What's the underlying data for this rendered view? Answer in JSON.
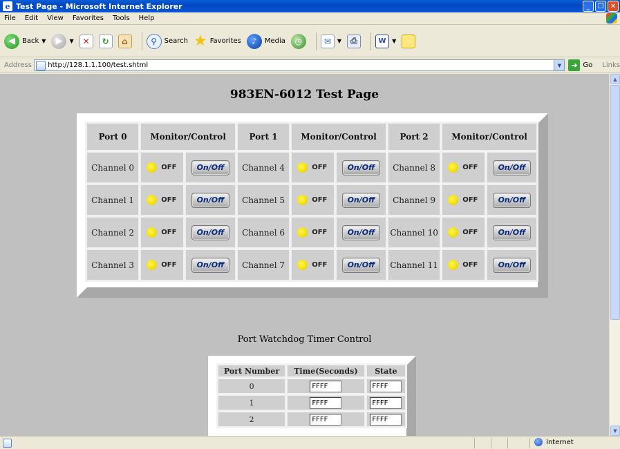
{
  "window": {
    "title": "Test Page - Microsoft Internet Explorer"
  },
  "menu": [
    "File",
    "Edit",
    "View",
    "Favorites",
    "Tools",
    "Help"
  ],
  "toolbar": {
    "back": "Back",
    "search": "Search",
    "favorites": "Favorites",
    "media": "Media"
  },
  "address": {
    "label": "Address",
    "url": "http://128.1.1.100/test.shtml",
    "go": "Go",
    "links": "Links"
  },
  "page": {
    "title": "983EN-6012 Test Page"
  },
  "io_table": {
    "headers": [
      "Port 0",
      "Monitor/Control",
      "Port 1",
      "Monitor/Control",
      "Port 2",
      "Monitor/Control"
    ],
    "button_label": "On/Off",
    "rows": [
      [
        {
          "channel": "Channel 0",
          "state": "OFF"
        },
        {
          "channel": "Channel 4",
          "state": "OFF"
        },
        {
          "channel": "Channel 8",
          "state": "OFF"
        }
      ],
      [
        {
          "channel": "Channel 1",
          "state": "OFF"
        },
        {
          "channel": "Channel 5",
          "state": "OFF"
        },
        {
          "channel": "Channel 9",
          "state": "OFF"
        }
      ],
      [
        {
          "channel": "Channel 2",
          "state": "OFF"
        },
        {
          "channel": "Channel 6",
          "state": "OFF"
        },
        {
          "channel": "Channel 10",
          "state": "OFF"
        }
      ],
      [
        {
          "channel": "Channel 3",
          "state": "OFF"
        },
        {
          "channel": "Channel 7",
          "state": "OFF"
        },
        {
          "channel": "Channel 11",
          "state": "OFF"
        }
      ]
    ],
    "led_color": "#f0dc0a"
  },
  "watchdog": {
    "title": "Port Watchdog Timer Control",
    "headers": [
      "Port Number",
      "Time(Seconds)",
      "State"
    ],
    "rows": [
      {
        "port": "0",
        "time": "FFFF",
        "state": "FFFF"
      },
      {
        "port": "1",
        "time": "FFFF",
        "state": "FFFF"
      },
      {
        "port": "2",
        "time": "FFFF",
        "state": "FFFF"
      }
    ]
  },
  "status": {
    "zone": "Internet"
  }
}
